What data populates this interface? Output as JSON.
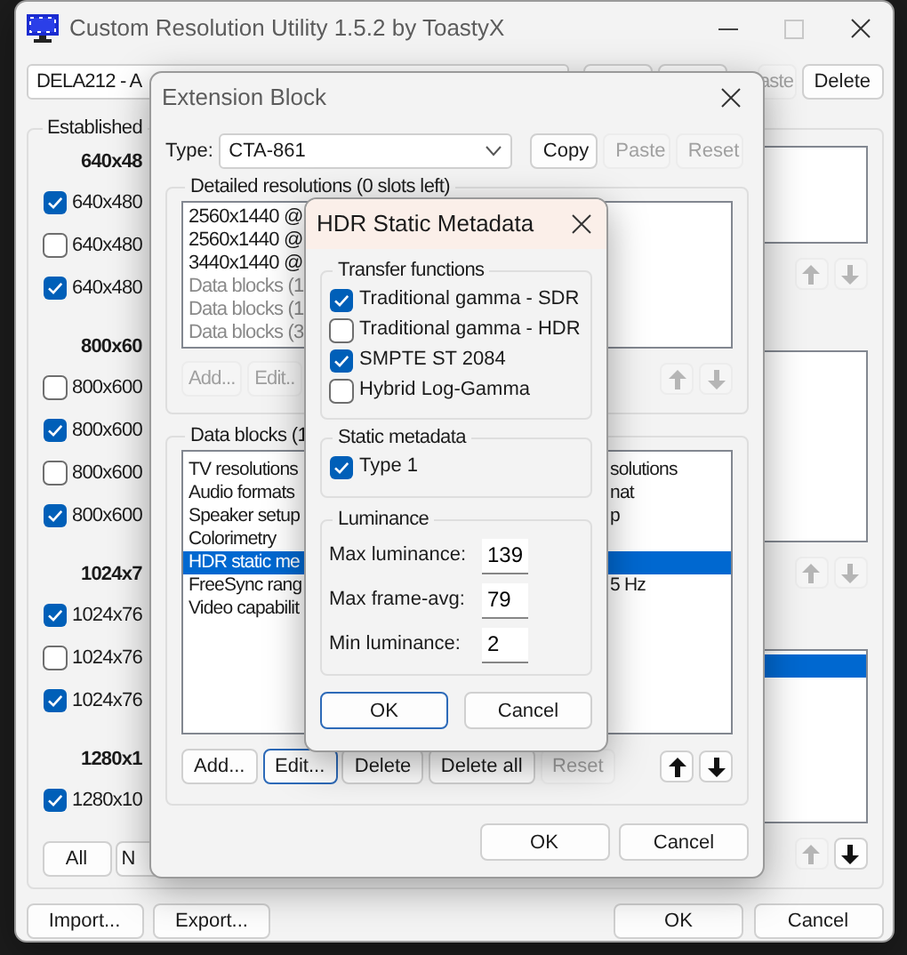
{
  "main_window": {
    "title": "Custom Resolution Utility 1.5.2 by ToastyX",
    "device_select": "DELA212 - A",
    "top_buttons": [
      {
        "label": "aste",
        "disabled": true
      },
      {
        "label": "Delete",
        "disabled": false
      }
    ],
    "established": {
      "title": "Established",
      "groups": [
        {
          "heading": "640x48",
          "modes": [
            {
              "label": "640x480",
              "checked": true
            },
            {
              "label": "640x480",
              "checked": false
            },
            {
              "label": "640x480",
              "checked": true
            }
          ]
        },
        {
          "heading": "800x60",
          "modes": [
            {
              "label": "800x600",
              "checked": false
            },
            {
              "label": "800x600",
              "checked": true
            },
            {
              "label": "800x600",
              "checked": false
            },
            {
              "label": "800x600",
              "checked": true
            }
          ]
        },
        {
          "heading": "1024x7",
          "modes": [
            {
              "label": "1024x76",
              "checked": true
            },
            {
              "label": "1024x76",
              "checked": false
            },
            {
              "label": "1024x76",
              "checked": true
            }
          ]
        },
        {
          "heading": "1280x1",
          "modes": [
            {
              "label": "1280x10",
              "checked": true
            }
          ]
        }
      ],
      "select_buttons": [
        {
          "label": "All"
        },
        {
          "label": "N"
        }
      ]
    },
    "side_lists": [
      {
        "row_selected": false,
        "up_disabled": true,
        "down_disabled": true
      },
      {
        "row_selected": false,
        "up_disabled": true,
        "down_disabled": true
      },
      {
        "row_selected": true,
        "up_disabled": true,
        "down_disabled": false
      }
    ],
    "footer_left": [
      {
        "label": "Import..."
      },
      {
        "label": "Export..."
      }
    ],
    "footer_right": [
      {
        "label": "OK"
      },
      {
        "label": "Cancel"
      }
    ]
  },
  "extension_dialog": {
    "title": "Extension Block",
    "type_label": "Type:",
    "type_value": "CTA-861",
    "type_buttons": [
      {
        "label": "Copy",
        "disabled": false
      },
      {
        "label": "Paste",
        "disabled": true
      },
      {
        "label": "Reset",
        "disabled": true
      }
    ],
    "detailed": {
      "title": "Detailed resolutions (0 slots left)",
      "rows": [
        {
          "text": "2560x1440 @",
          "muted": false
        },
        {
          "text": "2560x1440 @",
          "muted": false
        },
        {
          "text": "3440x1440 @",
          "muted": false
        },
        {
          "text": "Data blocks (1",
          "muted": true
        },
        {
          "text": "Data blocks (1",
          "muted": true
        },
        {
          "text": "Data blocks (3",
          "muted": true
        }
      ],
      "buttons": [
        {
          "label": "Add...",
          "disabled": true,
          "focused": false
        },
        {
          "label": "Edit..",
          "disabled": true,
          "focused": false
        }
      ],
      "up_disabled": true,
      "down_disabled": true
    },
    "data_blocks": {
      "title": "Data blocks (1",
      "rows": [
        {
          "text": "TV resolutions",
          "tail": "solutions",
          "selected": false
        },
        {
          "text": "Audio formats",
          "tail": "nat",
          "selected": false
        },
        {
          "text": "Speaker setup",
          "tail": "p",
          "selected": false
        },
        {
          "text": "Colorimetry",
          "selected": false
        },
        {
          "text": "HDR static me",
          "selected": true
        },
        {
          "text": "FreeSync rang",
          "tail": "5 Hz",
          "selected": false
        },
        {
          "text": "Video capabilit",
          "selected": false
        }
      ],
      "buttons": [
        {
          "label": "Add...",
          "disabled": false,
          "focused": false
        },
        {
          "label": "Edit...",
          "disabled": false,
          "focused": true
        },
        {
          "label": "Delete",
          "disabled": false,
          "focused": false
        },
        {
          "label": "Delete all",
          "disabled": false,
          "focused": false
        },
        {
          "label": "Reset",
          "disabled": true,
          "focused": false
        }
      ],
      "up_disabled": false,
      "down_disabled": false
    },
    "buttons": [
      {
        "label": "OK",
        "focused": false
      },
      {
        "label": "Cancel",
        "focused": false
      }
    ]
  },
  "hdr_dialog": {
    "title": "HDR Static Metadata",
    "transfer": {
      "title": "Transfer functions",
      "options": [
        {
          "label": "Traditional gamma - SDR",
          "checked": true
        },
        {
          "label": "Traditional gamma - HDR",
          "checked": false
        },
        {
          "label": "SMPTE ST 2084",
          "checked": true
        },
        {
          "label": "Hybrid Log-Gamma",
          "checked": false
        }
      ]
    },
    "static": {
      "title": "Static metadata",
      "options": [
        {
          "label": "Type 1",
          "checked": true
        }
      ]
    },
    "luminance": {
      "title": "Luminance",
      "fields": [
        {
          "label": "Max luminance:",
          "value": "139"
        },
        {
          "label": "Max frame-avg:",
          "value": "79"
        },
        {
          "label": "Min luminance:",
          "value": "2"
        }
      ]
    },
    "buttons": [
      {
        "label": "OK",
        "focused": true
      },
      {
        "label": "Cancel",
        "focused": false
      }
    ]
  }
}
